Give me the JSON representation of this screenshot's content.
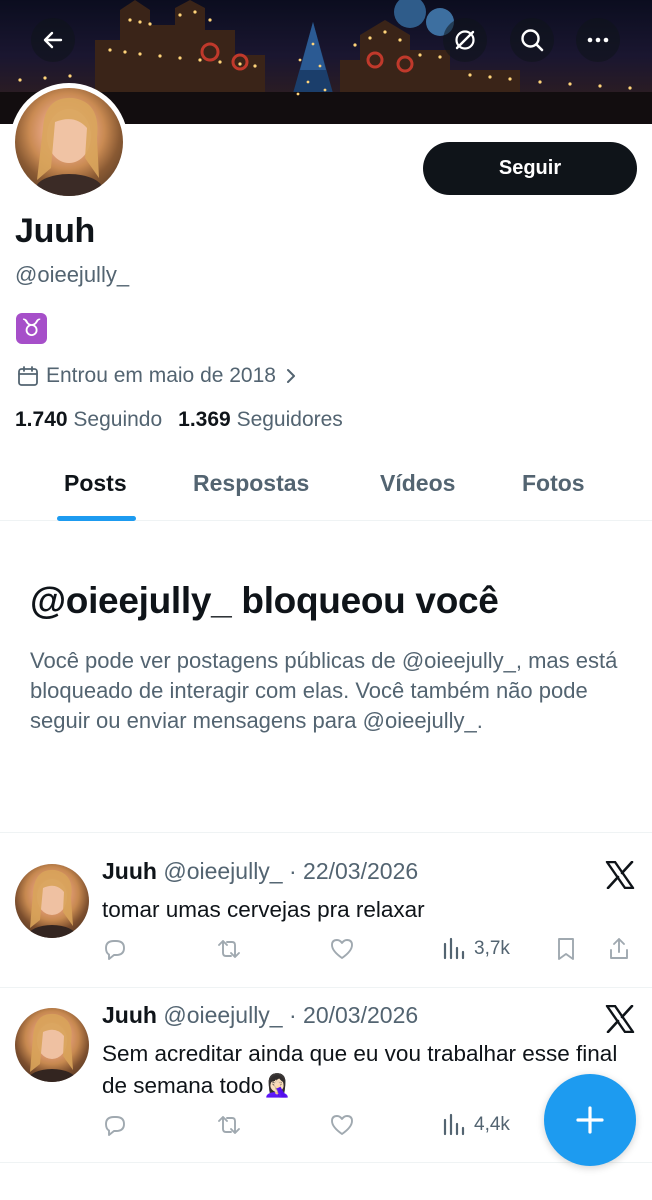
{
  "header": {
    "back_icon": "arrow-left-icon",
    "grok_icon": "grok-icon",
    "search_icon": "search-icon",
    "more_icon": "more-horizontal-icon"
  },
  "profile": {
    "display_name": "Juuh",
    "handle": "@oieejully_",
    "bio": "♉",
    "joined_icon": "calendar-icon",
    "joined": "Entrou em maio de 2018",
    "following_count": "1.740",
    "following_label": "Seguindo",
    "followers_count": "1.369",
    "followers_label": "Seguidores",
    "follow_button": "Seguir"
  },
  "tabs": [
    {
      "label": "Posts",
      "active": true
    },
    {
      "label": "Respostas",
      "active": false
    },
    {
      "label": "Vídeos",
      "active": false
    },
    {
      "label": "Fotos",
      "active": false
    }
  ],
  "blocked": {
    "title": "@oieejully_ bloqueou você",
    "body": "Você pode ver postagens públicas de @oieejully_, mas está bloqueado de interagir com elas. Você também não pode seguir ou enviar mensagens para @oieejully_."
  },
  "posts": [
    {
      "name": "Juuh",
      "handle": "@oieejully_",
      "date": "· 22/03/2026",
      "text": "tomar umas cervejas pra relaxar",
      "views": "3,7k"
    },
    {
      "name": "Juuh",
      "handle": "@oieejully_",
      "date": "· 20/03/2026",
      "text": "Sem acreditar ainda que eu vou trabalhar esse final de semana todo🤦🏻‍♀️",
      "views": "4,4k"
    }
  ],
  "fab": {
    "icon": "plus-icon"
  },
  "colors": {
    "accent": "#1d9bf0",
    "text_primary": "#0f1419",
    "text_secondary": "#536471",
    "button_dark": "#0f1419"
  }
}
